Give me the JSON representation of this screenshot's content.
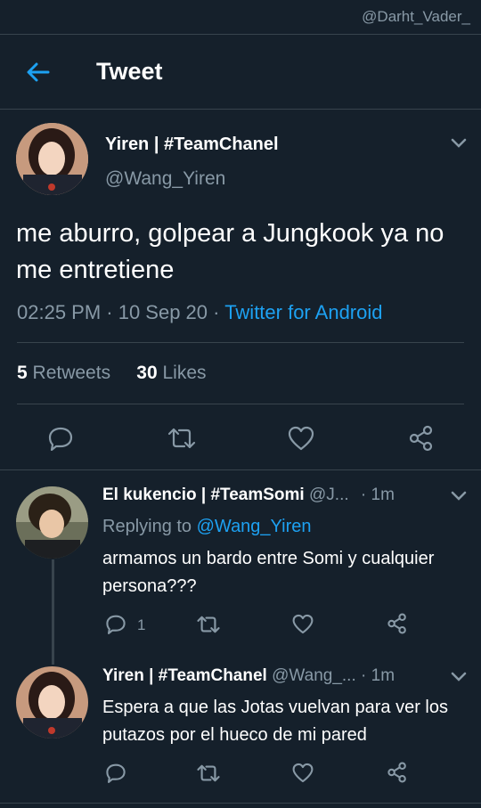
{
  "watermark": "@Darht_Vader_",
  "header": {
    "title": "Tweet"
  },
  "tweet": {
    "name": "Yiren | #TeamChanel",
    "handle": "@Wang_Yiren",
    "text": "me aburro, golpear a Jungkook ya no me entretiene",
    "time": "02:25 PM · 10 Sep 20 · ",
    "source": "Twitter for Android",
    "retweets_count": "5",
    "retweets_label": "Retweets",
    "likes_count": "30",
    "likes_label": "Likes"
  },
  "replies": [
    {
      "name": "El kukencio | #TeamSomi",
      "handle": "@J...",
      "time": "· 1m",
      "replying_label": "Replying to",
      "replying_handle": "@Wang_Yiren",
      "text": "armamos un bardo entre Somi y cualquier persona???",
      "reply_count": "1"
    },
    {
      "name": "Yiren | #TeamChanel",
      "handle": "@Wang_...",
      "time": "· 1m",
      "text": "Espera a que las Jotas vuelvan para ver los putazos por el hueco de mi pared"
    }
  ],
  "colors": {
    "background": "#15202b",
    "accent": "#1da1f2",
    "muted": "#8899a6",
    "divider": "#38444d"
  },
  "icons": [
    "back-arrow-icon",
    "chevron-down-icon",
    "reply-icon",
    "retweet-icon",
    "like-icon",
    "share-icon"
  ]
}
